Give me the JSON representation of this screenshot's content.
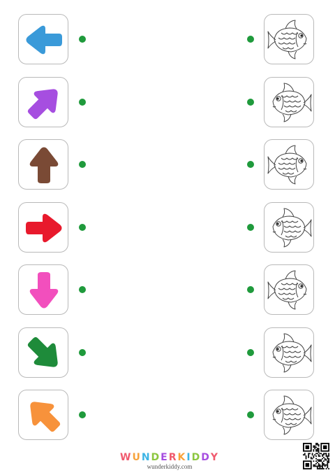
{
  "rows": [
    {
      "arrow": {
        "direction": "left",
        "color": "#3a9ad9"
      },
      "fish": {
        "facing": "right"
      }
    },
    {
      "arrow": {
        "direction": "up-right",
        "color": "#a64ee0"
      },
      "fish": {
        "facing": "left"
      }
    },
    {
      "arrow": {
        "direction": "up",
        "color": "#7a4a35"
      },
      "fish": {
        "facing": "right"
      }
    },
    {
      "arrow": {
        "direction": "right",
        "color": "#e8192c"
      },
      "fish": {
        "facing": "left"
      }
    },
    {
      "arrow": {
        "direction": "down",
        "color": "#f24fbd"
      },
      "fish": {
        "facing": "right"
      }
    },
    {
      "arrow": {
        "direction": "down-right",
        "color": "#1e8b3a"
      },
      "fish": {
        "facing": "left"
      }
    },
    {
      "arrow": {
        "direction": "up-left",
        "color": "#f7923b"
      },
      "fish": {
        "facing": "left"
      }
    }
  ],
  "dot_color": "#1f9a3c",
  "footer": {
    "logo_text": "WUNDERKIDDY",
    "logo_colors": [
      "#f05a6e",
      "#f7a23b",
      "#3cb4e5",
      "#8cc63f",
      "#a64ee0",
      "#f05a6e",
      "#f7a23b",
      "#3cb4e5",
      "#8cc63f",
      "#a64ee0",
      "#f05a6e"
    ],
    "url": "wunderkiddy.com"
  }
}
